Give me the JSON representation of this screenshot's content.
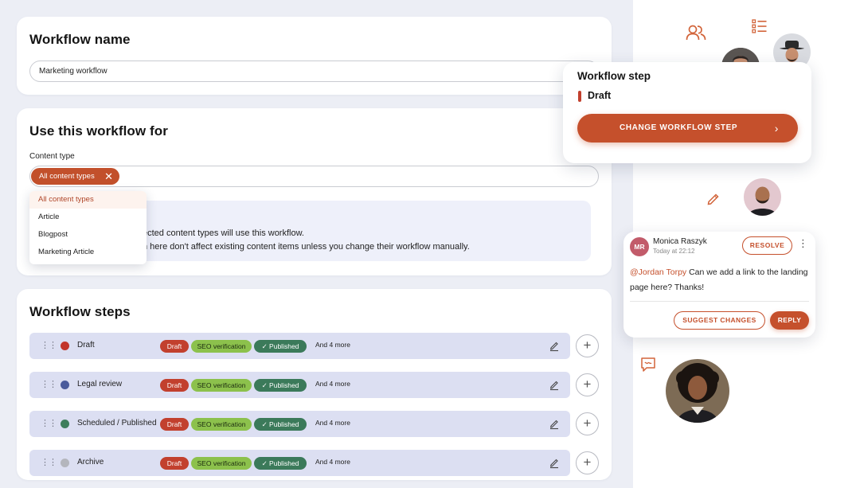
{
  "colors": {
    "accent": "#c5502c",
    "draft": "#c2402e",
    "seo": "#8cc14c",
    "published": "#3b7a5a",
    "row_bg": "#dcdff2",
    "page_bg": "#eceef5"
  },
  "workflow_name": {
    "title": "Workflow name",
    "value": "Marketing workflow"
  },
  "use_for": {
    "title": "Use this workflow for",
    "content_type_label": "Content type",
    "selected_chip": "All content types",
    "dropdown_options": [
      "All content types",
      "Article",
      "Blogpost",
      "Marketing Article"
    ],
    "info_line1": "ected content types will use this workflow.",
    "info_line2": "n here don't affect existing content items unless you change their workflow manually."
  },
  "steps": {
    "title": "Workflow steps",
    "rows": [
      {
        "name": "Draft",
        "dot_color": "#c2352b",
        "tags": [
          "Draft",
          "SEO verification",
          "✓ Published"
        ],
        "more": "And 4 more"
      },
      {
        "name": "Legal review",
        "dot_color": "#4a5b9c",
        "tags": [
          "Draft",
          "SEO verification",
          "✓ Published"
        ],
        "more": "And 4 more"
      },
      {
        "name": "Scheduled / Published",
        "dot_color": "#3e7e5c",
        "tags": [
          "Draft",
          "SEO verification",
          "✓ Published"
        ],
        "more": "And 4 more"
      },
      {
        "name": "Archive",
        "dot_color": "#b4b6bd",
        "tags": [
          "Draft",
          "SEO verification",
          "✓ Published"
        ],
        "more": "And 4 more"
      }
    ]
  },
  "workflow_step_popup": {
    "title": "Workflow step",
    "current_step": "Draft",
    "button_label": "CHANGE WORKFLOW STEP"
  },
  "comment": {
    "author_initials": "MR",
    "author": "Monica Raszyk",
    "time": "Today at 22:12",
    "mention": "@Jordan Torpy",
    "text": " Can we add a link to the landing page here? Thanks!",
    "resolve_label": "RESOLVE",
    "suggest_label": "SUGGEST CHANGES",
    "reply_label": "REPLY"
  },
  "icons": [
    "users-icon",
    "list-icon",
    "pencil-icon",
    "comment-icon",
    "drag-handle-icon",
    "edit-icon",
    "plus-icon",
    "close-icon",
    "chevron-right-icon",
    "kebab-menu-icon"
  ]
}
